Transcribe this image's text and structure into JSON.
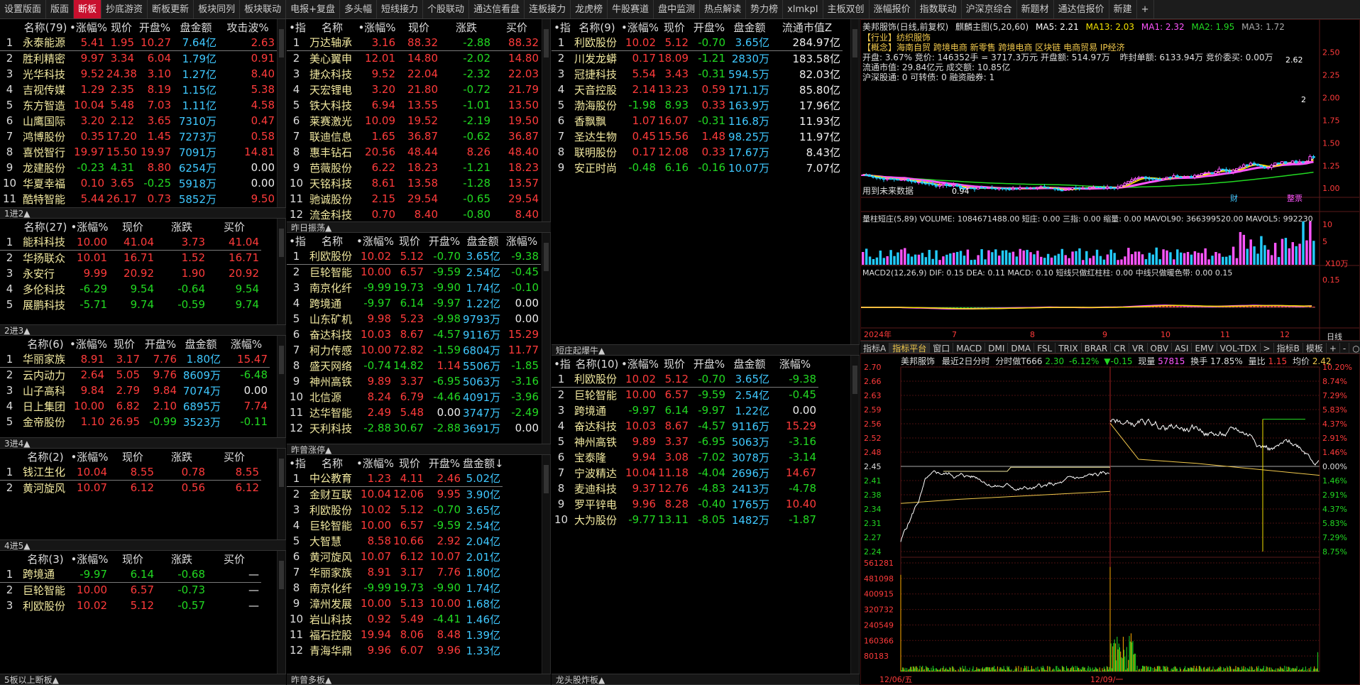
{
  "tabs": [
    {
      "label": "设置版面"
    },
    {
      "label": "版面"
    },
    {
      "label": "断板",
      "active": true
    },
    {
      "label": "抄底游资"
    },
    {
      "label": "断板更新"
    },
    {
      "label": "板块同列"
    },
    {
      "label": "板块联动"
    },
    {
      "label": "电报+复盘"
    },
    {
      "label": "多头幅"
    },
    {
      "label": "短线接力"
    },
    {
      "label": "个股联动"
    },
    {
      "label": "通达信看盘"
    },
    {
      "label": "连板接力"
    },
    {
      "label": "龙虎榜"
    },
    {
      "label": "牛股赛道"
    },
    {
      "label": "盘中监测"
    },
    {
      "label": "热点解读"
    },
    {
      "label": "势力榜"
    },
    {
      "label": "xlmkpl"
    },
    {
      "label": "主板双创"
    },
    {
      "label": "涨幅报价"
    },
    {
      "label": "指数联动"
    },
    {
      "label": "沪深京综合"
    },
    {
      "label": "新题材"
    },
    {
      "label": "通达信报价"
    },
    {
      "label": "新建"
    },
    {
      "label": "+"
    }
  ],
  "colors": {
    "up": "#ff3b3b",
    "down": "#22d922",
    "name": "#f2e9a0",
    "accent_tab": "#c8102e"
  },
  "p1": {
    "headers": [
      "",
      "名称(79)",
      "•涨幅%",
      "现价",
      "开盘%",
      "盘金额",
      "攻击波%"
    ],
    "rows": [
      [
        "1",
        "永泰能源",
        "5.41",
        "1.95",
        "10.27",
        "7.64亿",
        "2.63"
      ],
      [
        "2",
        "胜利精密",
        "9.97",
        "3.34",
        "6.04",
        "1.79亿",
        "0.91"
      ],
      [
        "3",
        "光华科技",
        "9.52",
        "24.38",
        "3.10",
        "1.27亿",
        "8.40"
      ],
      [
        "4",
        "吉视传媒",
        "1.29",
        "2.35",
        "8.19",
        "1.15亿",
        "5.38"
      ],
      [
        "5",
        "东方智造",
        "10.04",
        "5.48",
        "7.03",
        "1.11亿",
        "4.58"
      ],
      [
        "6",
        "山鹰国际",
        "3.20",
        "2.12",
        "3.65",
        "7310万",
        "0.47"
      ],
      [
        "7",
        "鸿博股份",
        "0.35",
        "17.20",
        "1.45",
        "7273万",
        "0.58"
      ],
      [
        "8",
        "喜悦智行",
        "19.97",
        "15.50",
        "19.97",
        "7091万",
        "14.81"
      ],
      [
        "9",
        "龙建股份",
        "-0.23",
        "4.31",
        "8.80",
        "6254万",
        "0.00"
      ],
      [
        "10",
        "华夏幸福",
        "0.10",
        "3.65",
        "-0.25",
        "5918万",
        "0.00"
      ],
      [
        "11",
        "酷特智能",
        "5.44",
        "26.17",
        "0.73",
        "5852万",
        "9.50"
      ]
    ],
    "footer": "1进2▲"
  },
  "p2": {
    "headers": [
      "",
      "名称(27)",
      "•涨幅%",
      "现价",
      "涨跌",
      "买价"
    ],
    "rows": [
      [
        "1",
        "能科科技",
        "10.00",
        "41.04",
        "3.73",
        "41.04"
      ],
      [
        "2",
        "华扬联众",
        "10.01",
        "16.71",
        "1.52",
        "16.71"
      ],
      [
        "3",
        "永安行",
        "9.99",
        "20.92",
        "1.90",
        "20.92"
      ],
      [
        "4",
        "多伦科技",
        "-6.29",
        "9.54",
        "-0.64",
        "9.54"
      ],
      [
        "5",
        "展鹏科技",
        "-5.71",
        "9.74",
        "-0.59",
        "9.74"
      ]
    ],
    "footer": "2进3▲"
  },
  "p3": {
    "headers": [
      "",
      "名称(6)",
      "•涨幅%",
      "现价",
      "开盘%",
      "盘金额",
      "涨幅%"
    ],
    "rows": [
      [
        "1",
        "华丽家族",
        "8.91",
        "3.17",
        "7.76",
        "1.80亿",
        "15.47"
      ],
      [
        "2",
        "云内动力",
        "2.64",
        "5.05",
        "9.76",
        "8609万",
        "-6.48"
      ],
      [
        "3",
        "山子高科",
        "9.84",
        "2.79",
        "9.84",
        "7074万",
        "0.00"
      ],
      [
        "4",
        "日上集团",
        "10.00",
        "6.82",
        "2.10",
        "6895万",
        "7.74"
      ],
      [
        "5",
        "金帝股份",
        "1.10",
        "26.95",
        "-0.99",
        "3523万",
        "-0.11"
      ]
    ],
    "footer": "3进4▲"
  },
  "p4": {
    "headers": [
      "",
      "名称(2)",
      "•涨幅%",
      "现价",
      "涨跌",
      "买价"
    ],
    "rows": [
      [
        "1",
        "钱江生化",
        "10.04",
        "8.55",
        "0.78",
        "8.55"
      ],
      [
        "2",
        "黄河旋风",
        "10.07",
        "6.12",
        "0.56",
        "6.12"
      ]
    ],
    "footer": "4进5▲"
  },
  "p5": {
    "headers": [
      "",
      "名称(3)",
      "•涨幅%",
      "现价",
      "涨跌",
      "买价"
    ],
    "rows": [
      [
        "1",
        "跨境通",
        "-9.97",
        "6.14",
        "-0.68",
        "—"
      ],
      [
        "2",
        "巨轮智能",
        "10.00",
        "6.57",
        "-0.73",
        "—"
      ],
      [
        "3",
        "利欧股份",
        "10.02",
        "5.12",
        "-0.57",
        "—"
      ]
    ],
    "footer": "5板以上断板▲"
  },
  "p6": {
    "headers": [
      "•指",
      "名称",
      "•涨幅%",
      "现价",
      "涨跌",
      "买价"
    ],
    "rows": [
      [
        "1",
        "万达轴承",
        "3.16",
        "88.32",
        "-2.88",
        "88.32"
      ],
      [
        "2",
        "美心翼申",
        "12.01",
        "14.80",
        "-2.02",
        "14.80"
      ],
      [
        "3",
        "捷众科技",
        "9.52",
        "22.04",
        "-2.32",
        "22.03"
      ],
      [
        "4",
        "天宏锂电",
        "3.20",
        "21.80",
        "-0.72",
        "21.79"
      ],
      [
        "5",
        "铁大科技",
        "6.94",
        "13.55",
        "-1.01",
        "13.50"
      ],
      [
        "6",
        "莱赛激光",
        "10.09",
        "19.52",
        "-2.19",
        "19.50"
      ],
      [
        "7",
        "联迪信息",
        "1.65",
        "36.87",
        "-0.62",
        "36.87"
      ],
      [
        "8",
        "惠丰钻石",
        "20.56",
        "48.44",
        "8.26",
        "48.40"
      ],
      [
        "9",
        "芭薇股份",
        "6.22",
        "18.23",
        "-1.21",
        "18.23"
      ],
      [
        "10",
        "天铭科技",
        "8.61",
        "13.58",
        "-1.28",
        "13.57"
      ],
      [
        "11",
        "驰诚股份",
        "2.15",
        "29.54",
        "-0.65",
        "29.54"
      ],
      [
        "12",
        "流金科技",
        "0.70",
        "8.40",
        "-0.80",
        "8.40"
      ]
    ],
    "footer": "昨日振荡▲"
  },
  "p7": {
    "headers": [
      "•指",
      "名称",
      "•涨幅%",
      "现价",
      "开盘%",
      "盘金额",
      "涨幅%"
    ],
    "rows": [
      [
        "1",
        "利欧股份",
        "10.02",
        "5.12",
        "-0.70",
        "3.65亿",
        "-9.38"
      ],
      [
        "2",
        "巨轮智能",
        "10.00",
        "6.57",
        "-9.59",
        "2.54亿",
        "-0.45"
      ],
      [
        "3",
        "南京化纤",
        "-9.99",
        "19.73",
        "-9.90",
        "1.74亿",
        "-0.10"
      ],
      [
        "4",
        "跨境通",
        "-9.97",
        "6.14",
        "-9.97",
        "1.22亿",
        "0.00"
      ],
      [
        "5",
        "山东矿机",
        "9.98",
        "5.23",
        "-9.98",
        "9793万",
        "0.00"
      ],
      [
        "6",
        "奋达科技",
        "10.03",
        "8.67",
        "-4.57",
        "9116万",
        "15.29"
      ],
      [
        "7",
        "柯力传感",
        "10.00",
        "72.82",
        "-1.59",
        "6804万",
        "11.77"
      ],
      [
        "8",
        "盛天网络",
        "-0.74",
        "14.82",
        "1.14",
        "5506万",
        "-1.85"
      ],
      [
        "9",
        "神州高铁",
        "9.89",
        "3.37",
        "-6.95",
        "5063万",
        "-3.16"
      ],
      [
        "10",
        "北信源",
        "8.24",
        "6.79",
        "-4.46",
        "4091万",
        "-3.96"
      ],
      [
        "11",
        "达华智能",
        "2.49",
        "5.48",
        "0.00",
        "3747万",
        "-2.49"
      ],
      [
        "12",
        "天利科技",
        "-2.88",
        "30.67",
        "-2.88",
        "3691万",
        "0.00"
      ]
    ],
    "footer": "昨曾涨停▲"
  },
  "p8": {
    "headers": [
      "•指",
      "名称",
      "•涨幅%",
      "现价",
      "开盘%",
      "盘金额↓"
    ],
    "rows": [
      [
        "1",
        "中公教育",
        "1.23",
        "4.11",
        "2.46",
        "5.02亿"
      ],
      [
        "2",
        "金财互联",
        "10.04",
        "12.06",
        "9.95",
        "3.90亿"
      ],
      [
        "3",
        "利欧股份",
        "10.02",
        "5.12",
        "-0.70",
        "3.65亿"
      ],
      [
        "4",
        "巨轮智能",
        "10.00",
        "6.57",
        "-9.59",
        "2.54亿"
      ],
      [
        "5",
        "大智慧",
        "8.58",
        "10.66",
        "2.92",
        "2.04亿"
      ],
      [
        "6",
        "黄河旋风",
        "10.07",
        "6.12",
        "10.07",
        "2.01亿"
      ],
      [
        "7",
        "华丽家族",
        "8.91",
        "3.17",
        "7.76",
        "1.80亿"
      ],
      [
        "8",
        "南京化纤",
        "-9.99",
        "19.73",
        "-9.90",
        "1.74亿"
      ],
      [
        "9",
        "漳州发展",
        "10.00",
        "5.13",
        "10.00",
        "1.68亿"
      ],
      [
        "10",
        "岩山科技",
        "0.92",
        "5.49",
        "-4.41",
        "1.46亿"
      ],
      [
        "11",
        "福石控股",
        "19.94",
        "8.06",
        "8.48",
        "1.39亿"
      ],
      [
        "12",
        "青海华鼎",
        "9.96",
        "6.07",
        "9.96",
        "1.33亿"
      ]
    ],
    "footer": "昨曾多板▲"
  },
  "p9": {
    "headers": [
      "•指",
      "名称(9)",
      "•涨幅%",
      "现价",
      "开盘%",
      "盘金额",
      "流通市值Z"
    ],
    "rows": [
      [
        "1",
        "利欧股份",
        "10.02",
        "5.12",
        "-0.70",
        "3.65亿",
        "284.97亿"
      ],
      [
        "2",
        "川发龙蟒",
        "0.17",
        "18.09",
        "-1.21",
        "2830万",
        "183.58亿"
      ],
      [
        "3",
        "冠捷科技",
        "5.54",
        "3.43",
        "-0.31",
        "594.5万",
        "82.03亿"
      ],
      [
        "4",
        "天音控股",
        "2.14",
        "13.23",
        "0.59",
        "171.1万",
        "85.80亿"
      ],
      [
        "5",
        "渤海股份",
        "-1.98",
        "8.93",
        "0.33",
        "163.9万",
        "17.96亿"
      ],
      [
        "6",
        "香飘飘",
        "1.07",
        "16.07",
        "-0.31",
        "116.8万",
        "11.93亿"
      ],
      [
        "7",
        "圣达生物",
        "0.45",
        "15.56",
        "1.48",
        "98.25万",
        "11.97亿"
      ],
      [
        "8",
        "联明股份",
        "0.17",
        "12.08",
        "0.33",
        "17.67万",
        "8.43亿"
      ],
      [
        "9",
        "安正时尚",
        "-0.48",
        "6.16",
        "-0.16",
        "10.07万",
        "7.07亿"
      ]
    ],
    "footer": "短庄起爆牛▲"
  },
  "p10": {
    "headers": [
      "•指",
      "名称(10)",
      "•涨幅%",
      "现价",
      "开盘%",
      "盘金额",
      "涨幅%"
    ],
    "rows": [
      [
        "1",
        "利欧股份",
        "10.02",
        "5.12",
        "-0.70",
        "3.65亿",
        "-9.38"
      ],
      [
        "2",
        "巨轮智能",
        "10.00",
        "6.57",
        "-9.59",
        "2.54亿",
        "-0.45"
      ],
      [
        "3",
        "跨境通",
        "-9.97",
        "6.14",
        "-9.97",
        "1.22亿",
        "0.00"
      ],
      [
        "4",
        "奋达科技",
        "10.03",
        "8.67",
        "-4.57",
        "9116万",
        "15.29"
      ],
      [
        "5",
        "神州高铁",
        "9.89",
        "3.37",
        "-6.95",
        "5063万",
        "-3.16"
      ],
      [
        "6",
        "宝泰隆",
        "9.94",
        "3.08",
        "-7.02",
        "3078万",
        "-3.14"
      ],
      [
        "7",
        "宁波精达",
        "10.04",
        "11.18",
        "-4.04",
        "2696万",
        "14.67"
      ],
      [
        "8",
        "麦迪科技",
        "9.37",
        "12.76",
        "-4.83",
        "2413万",
        "-4.78"
      ],
      [
        "9",
        "罗平锌电",
        "9.96",
        "8.28",
        "-0.40",
        "1765万",
        "10.40"
      ],
      [
        "10",
        "大为股份",
        "-9.77",
        "13.11",
        "-8.05",
        "1482万",
        "-1.87"
      ]
    ],
    "footer": "龙头股炸板▲"
  },
  "kline": {
    "title": "美邦服饰(日线,前复权)",
    "indicator": "麒麟主图(5,20,60)",
    "ma_vals": [
      "MA5: 2.21",
      "MA13: 2.03",
      "MA1: 2.32",
      "MA2: 1.95",
      "MA3: 1.72"
    ],
    "industry": "【行业】纺织服饰",
    "concepts": "【概念】海南自贸 跨境电商 新零售 跨境电商 区块链 电商贸易 IP经济",
    "stats1": "开盘: 3.67%   竞价: 146352手 = 3717.3万元   开盘额: 514.97万",
    "stats1b": "昨封单额: 6133.94万   竞价委买: 0.00万",
    "stats2": "流通市值: 29.84亿元   成交额: 10.85亿",
    "stats3": "沪深股通: 0   可转债: 0   融资融券: 1",
    "future_note": "用到未来数据",
    "price_ticks": [
      "2.50",
      "2.25",
      "2.00",
      "1.75",
      "1.50",
      "1.25",
      "1.00"
    ],
    "high_label": "2.62",
    "low_label": "0.94",
    "right_mark": "2",
    "marks": [
      "财",
      "整票"
    ],
    "vol_title": "量柱短庄(5,89)  VOLUME: 1084671488.00  短庄: 0.00  三指: 0.00  缩量: 0.00  MAVOL90: 366399520.00  MAVOL5: 992230",
    "vol_ticks": [
      "10",
      "5"
    ],
    "vol_unit": "X10万",
    "macd_title": "MACD2(12,26,9)  DIF: 0.15  DEA: 0.11  MACD: 0.10  短线只做红柱柱: 0.00  中线只做暖色带: 0.00  0.15",
    "macd_tick": "0.15",
    "date_labels": [
      "2024年",
      "7",
      "8",
      "9",
      "10",
      "11",
      "12"
    ],
    "date_unit": "日线"
  },
  "subtabs": [
    "指标A",
    "指标平台",
    "窗口",
    "MACD",
    "DMI",
    "DMA",
    "FSL",
    "TRIX",
    "BRAR",
    "CR",
    "VR",
    "OBV",
    "ASI",
    "EMV",
    "VOL-TDX",
    ">",
    "指标B",
    "模板",
    "+",
    "-",
    "○"
  ],
  "intraday": {
    "header_name": "美邦服饰",
    "header_days": "最近2日分时",
    "header_prefix": "分时做T666",
    "header_price": "2.30",
    "header_pct": "-6.12%",
    "header_chg": "▼-0.15",
    "header_vol_label": "现量",
    "header_vol": "57815",
    "header_turn": "换手 17.85%",
    "header_ratio_label": "量比",
    "header_ratio": "1.15",
    "header_avg_label": "均价",
    "header_avg": "2.42",
    "price_ticks": [
      "2.70",
      "2.66",
      "2.63",
      "2.59",
      "2.56",
      "2.52",
      "2.48",
      "2.45",
      "2.41",
      "2.38",
      "2.34",
      "2.31",
      "2.27",
      "2.24"
    ],
    "pct_ticks": [
      "10.20%",
      "8.74%",
      "7.29%",
      "5.83%",
      "4.37%",
      "2.91%",
      "1.46%",
      "0.00%",
      "1.46%",
      "2.91%",
      "4.37%",
      "5.83%",
      "7.29%",
      "8.75%"
    ],
    "vol_ticks": [
      "561281",
      "481098",
      "400915",
      "320732",
      "240549",
      "160366",
      "80183"
    ],
    "date_labels": [
      "12/06/五",
      "12/09/一"
    ]
  }
}
